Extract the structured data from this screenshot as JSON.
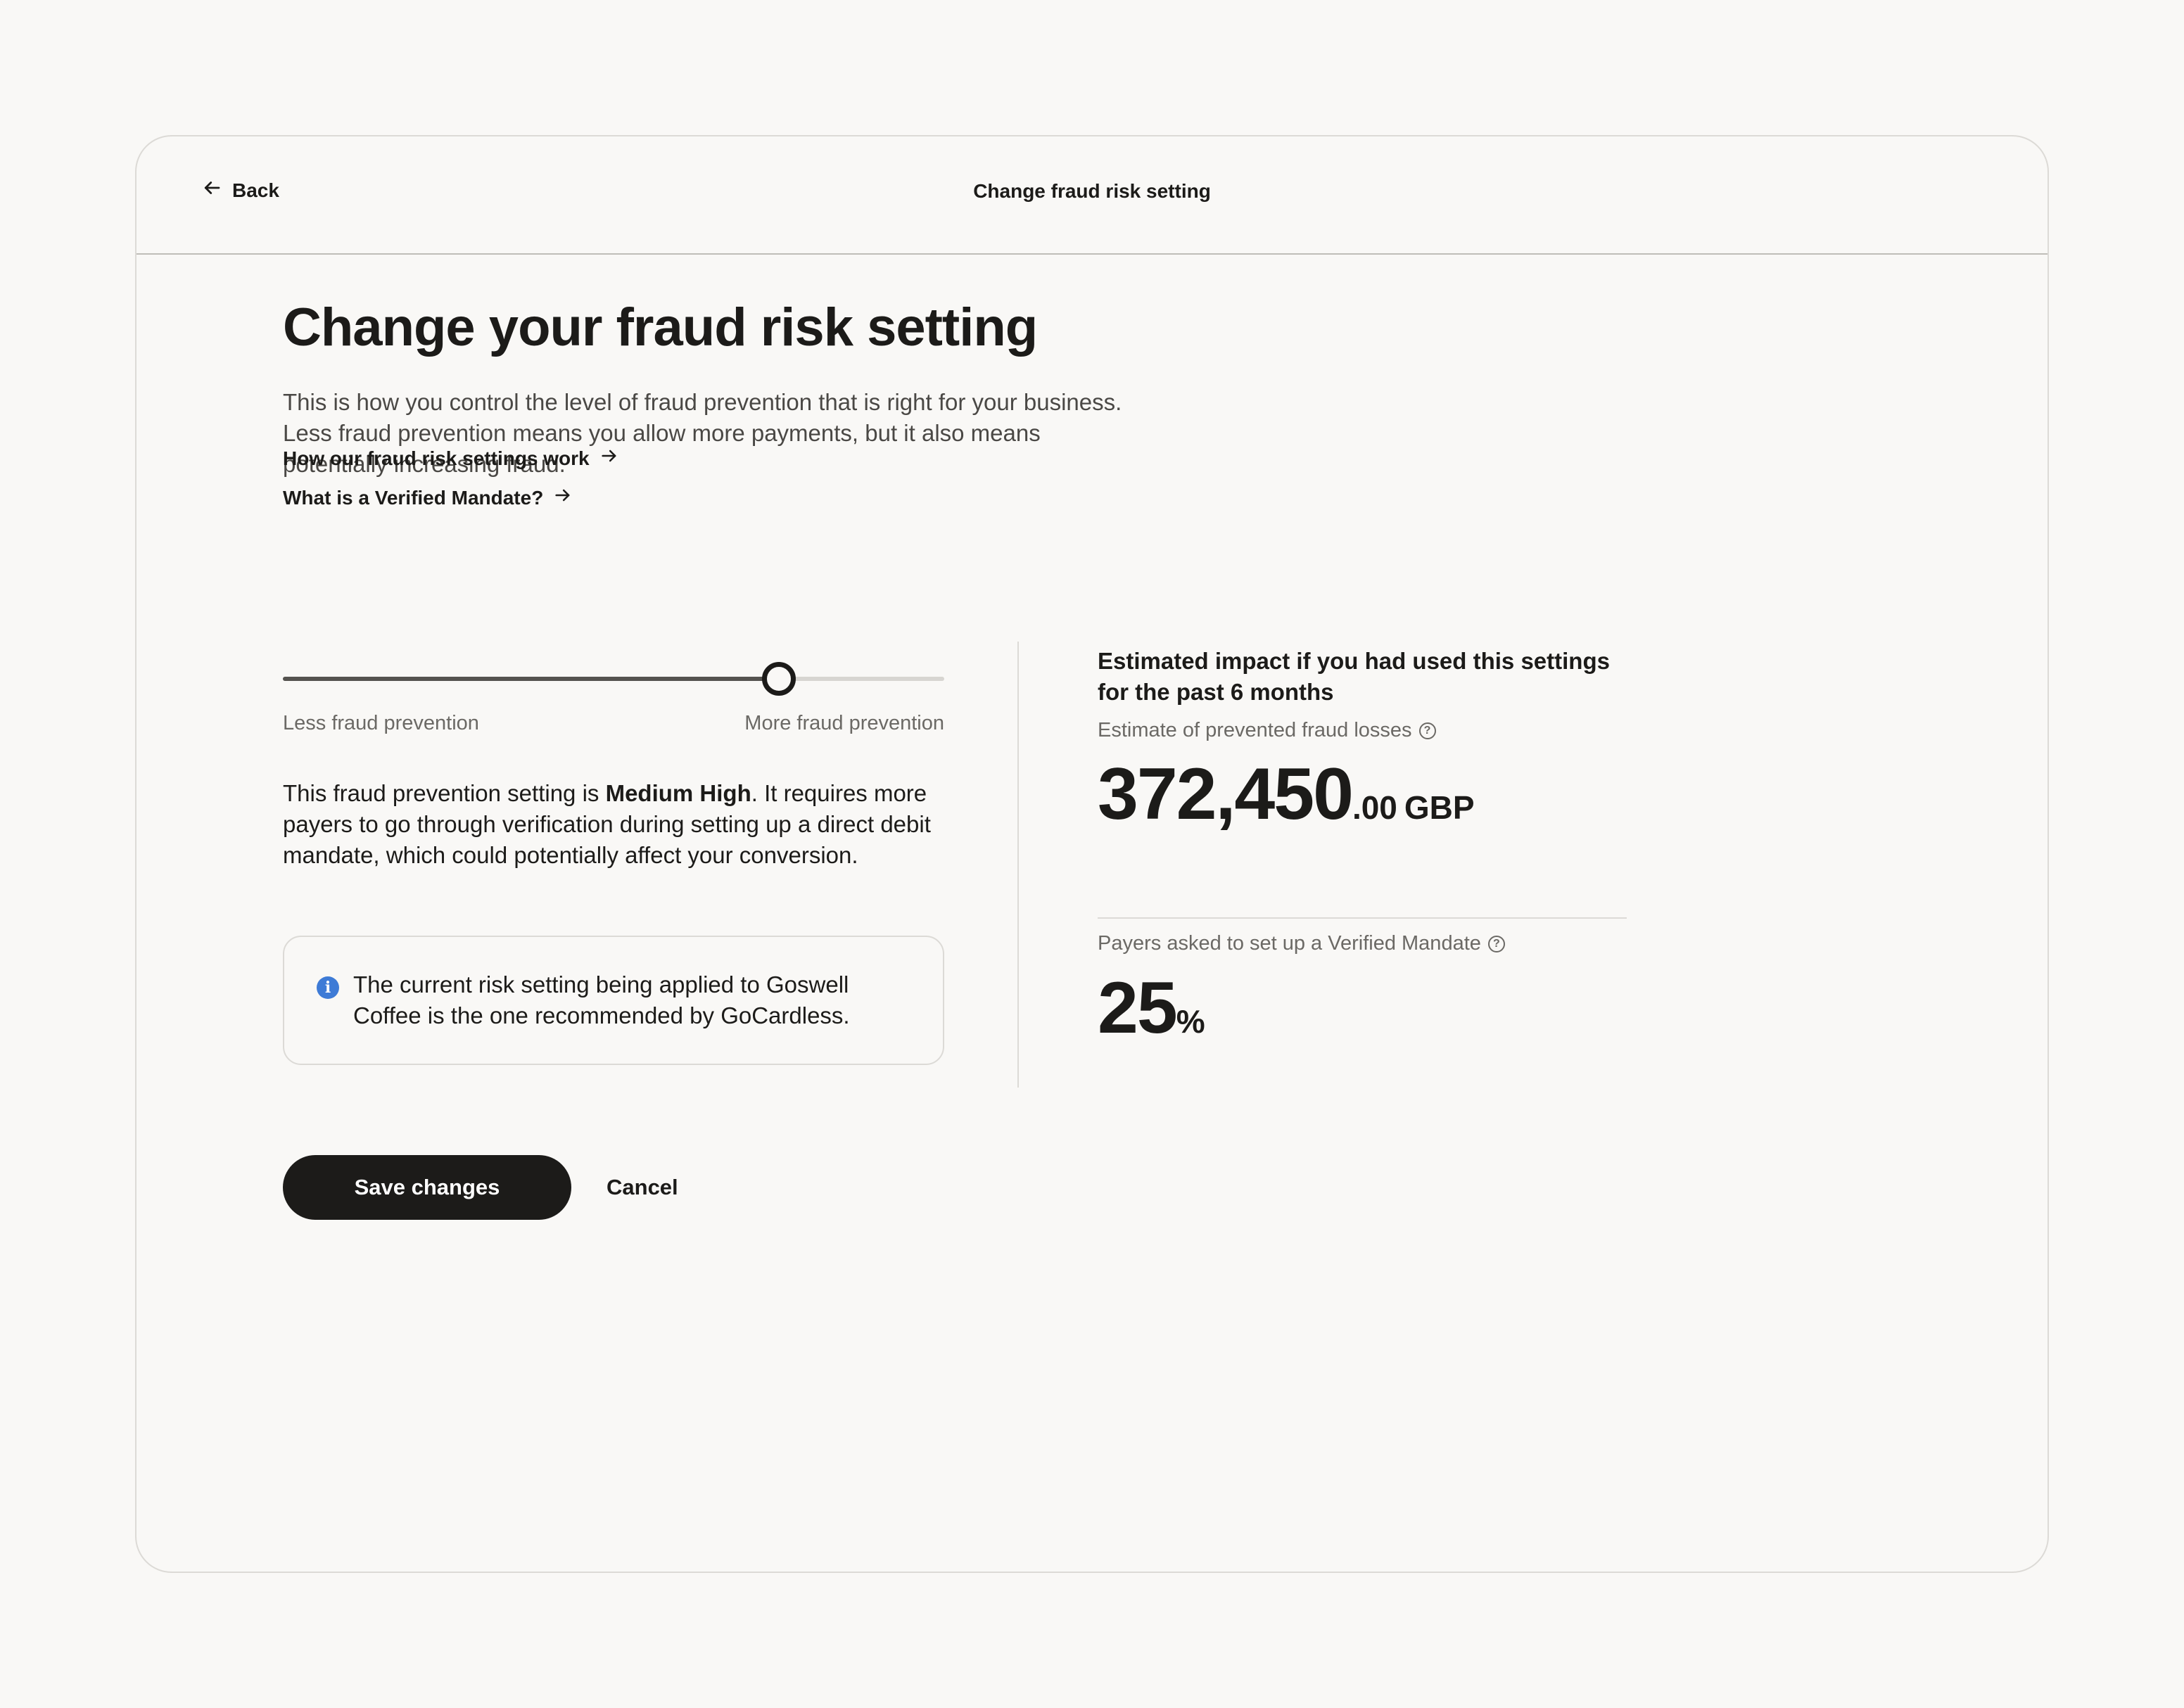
{
  "header": {
    "back_label": "Back",
    "title": "Change fraud risk setting"
  },
  "main": {
    "heading": "Change your fraud risk setting",
    "intro": "This is how you control the level of fraud prevention that is right for your business. Less fraud prevention means you allow more payments, but it also means potentially increasing fraud.",
    "links": [
      {
        "label": "How our fraud risk settings work",
        "icon": "arrow-right-icon"
      },
      {
        "label": "What is a Verified Mandate?",
        "icon": "arrow-right-icon"
      }
    ],
    "slider": {
      "min_label": "Less fraud prevention",
      "max_label": "More fraud prevention",
      "value_fraction": 0.75
    },
    "setting_desc": {
      "prefix": "This fraud prevention setting is ",
      "level": "Medium High",
      "suffix": ". It requires more payers to go through verification during setting up a direct debit mandate, which could potentially affect your conversion."
    },
    "info_box": {
      "icon": "info-icon",
      "text": "The current risk setting being applied to Goswell Coffee is the one recommended by GoCardless."
    },
    "impact": {
      "title": "Estimated impact if you had used this settings for the past 6 months",
      "fraud_losses": {
        "label": "Estimate of prevented fraud losses",
        "integer": "372,450",
        "decimals": ".00",
        "currency": "GBP"
      },
      "verified_mandate": {
        "label": "Payers asked to set up a Verified Mandate",
        "value": "25",
        "unit": "%"
      }
    },
    "actions": {
      "save_label": "Save changes",
      "cancel_label": "Cancel"
    }
  },
  "colors": {
    "background": "#f9f8f6",
    "text": "#1c1b19",
    "muted": "#6b6965",
    "border": "#dcdad6",
    "info_blue": "#3e7bd6",
    "primary_button": "#1c1b19"
  }
}
